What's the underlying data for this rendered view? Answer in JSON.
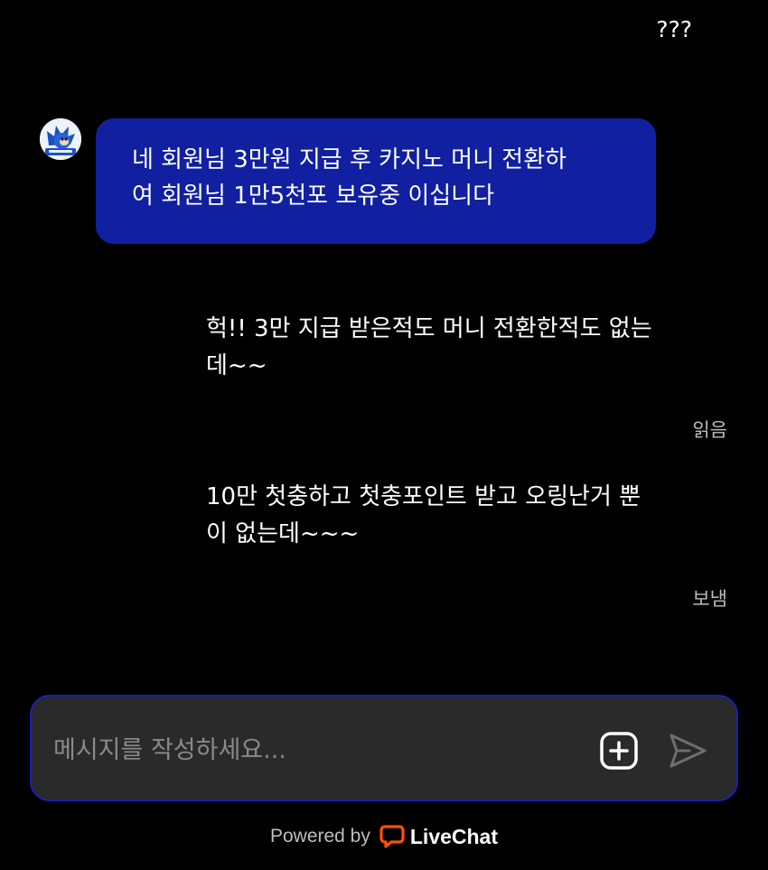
{
  "messages": {
    "top_visitor": "???",
    "agent_message": "네 회원님 3만원 지급 후 카지노 머니 전환하\n여 회원님 1만5천포 보유중 이십니다",
    "visitor_1": "헉!! 3만 지급 받은적도 머니 전환한적도 없는\n데~~",
    "visitor_1_status": "읽음",
    "visitor_2": "10만 첫충하고 첫충포인트 받고 오링난거 뿐\n이 없는데~~~",
    "visitor_2_status": "보냄"
  },
  "composer": {
    "placeholder": "메시지를 작성하세요...",
    "value": ""
  },
  "footer": {
    "powered_by": "Powered by",
    "brand": "LiveChat"
  },
  "colors": {
    "background": "#000000",
    "agent_bubble": "#1120a0",
    "composer_bg": "#2a2a2a",
    "composer_border": "#1a1fb4",
    "status_text": "#bdbdbd",
    "brand_orange": "#ff5100"
  },
  "icons": {
    "avatar": "agent-avatar-icon",
    "attach": "add-attachment-icon",
    "send": "send-icon",
    "brand": "livechat-logo-icon"
  }
}
